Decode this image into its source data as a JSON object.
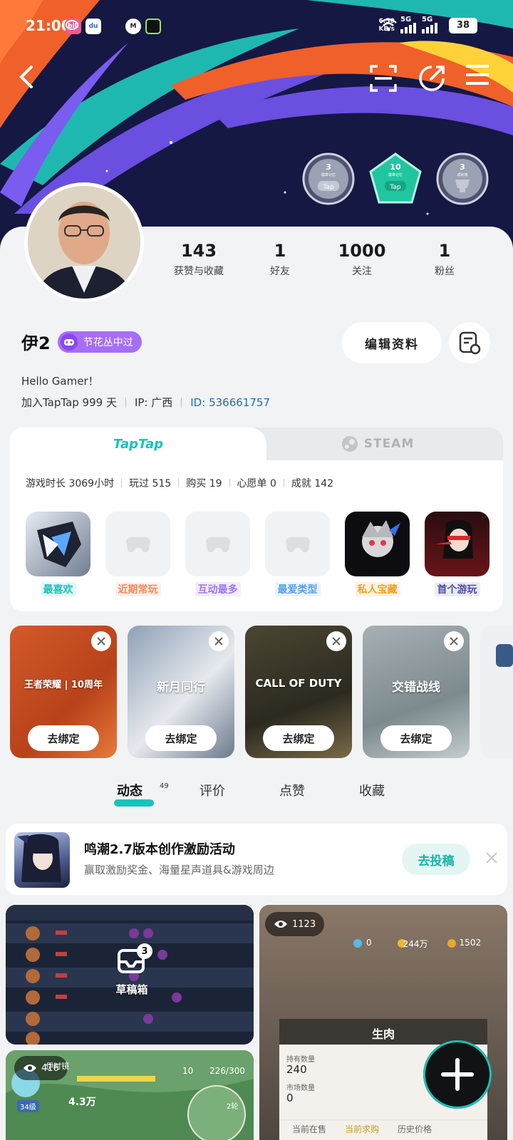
{
  "status_bar": {
    "time": "21:00",
    "net_speed_value": "6.50",
    "net_speed_unit": "KB/s",
    "signal_1": "5G",
    "signal_2": "5G",
    "battery": "38"
  },
  "header": {
    "back_icon": "chevron-left-icon",
    "scan_icon": "scan-icon",
    "share_icon": "share-icon",
    "menu_icon": "menu-icon"
  },
  "badges": [
    {
      "num": "3",
      "caption": "徽章记忆",
      "icon": "tap-badge-icon",
      "label": "Tap"
    },
    {
      "num": "10",
      "caption": "徽章记忆",
      "icon": "tap-badge-icon",
      "label": "Tap"
    },
    {
      "num": "3",
      "caption": "成就墙",
      "icon": "trophy-icon"
    }
  ],
  "stats": [
    {
      "value": "143",
      "label": "获赞与收藏"
    },
    {
      "value": "1",
      "label": "好友"
    },
    {
      "value": "1000",
      "label": "关注"
    },
    {
      "value": "1",
      "label": "粉丝"
    }
  ],
  "profile": {
    "username": "伊2",
    "tag": "节花丛中过",
    "edit_button": "编辑资料",
    "bio": "Hello Gamer！",
    "joined": "加入TapTap 999 天",
    "ip": "IP: 广西",
    "id_label": "ID:",
    "id_value": "536661757"
  },
  "game_card": {
    "tab_taptap": "TapTap",
    "tab_steam": "STEAM",
    "stats": [
      "游戏时长 3069小时",
      "玩过 515",
      "购买 19",
      "心愿单 0",
      "成就 142"
    ],
    "games": [
      {
        "label": "最喜欢",
        "color": "#19c2b8",
        "bg": "#e3f7f5"
      },
      {
        "label": "近期常玩",
        "color": "#f08a5a",
        "bg": "#fdf0ea"
      },
      {
        "label": "互动最多",
        "color": "#a07ae8",
        "bg": "#f2ecfc"
      },
      {
        "label": "最爱类型",
        "color": "#5aa0e8",
        "bg": "#ebf3fc"
      },
      {
        "label": "私人宝藏",
        "color": "#f0a020",
        "bg": "#fdf3e1"
      },
      {
        "label": "首个游玩",
        "color": "#4a4aa8",
        "bg": "#ebebf8"
      }
    ]
  },
  "bind_cards": [
    {
      "title": "王者荣耀 | 10周年",
      "button": "去绑定"
    },
    {
      "title": "新月同行",
      "button": "去绑定"
    },
    {
      "title": "CALL OF DUTY",
      "button": "去绑定"
    },
    {
      "title": "交错战线",
      "button": "去绑定"
    }
  ],
  "content_tabs": {
    "tabs": [
      "动态",
      "评价",
      "点赞",
      "收藏"
    ],
    "active_count": "49"
  },
  "promo": {
    "title": "鸣潮2.7版本创作激励活动",
    "subtitle": "赢取激励奖金、海量星声道具&游戏周边",
    "button": "去投稿"
  },
  "feed": {
    "draft_label": "草稿箱",
    "draft_count": "3",
    "views_b": "1123",
    "views_c": "416",
    "b_currency_1": "0",
    "b_currency_2": "244万",
    "b_currency_3": "1502",
    "b_panel_title": "生肉",
    "b_hold_label": "持有数量",
    "b_hold_value": "240",
    "b_market_label": "市场数量",
    "b_market_value": "0",
    "b_tabs": [
      "当前在售",
      "当前求购",
      "历史价格"
    ],
    "c_name": "伊时镜",
    "c_level": "34级",
    "c_power": "4.3万",
    "c_hp": "10",
    "c_energy": "226/300",
    "c_wave": "2轮"
  }
}
